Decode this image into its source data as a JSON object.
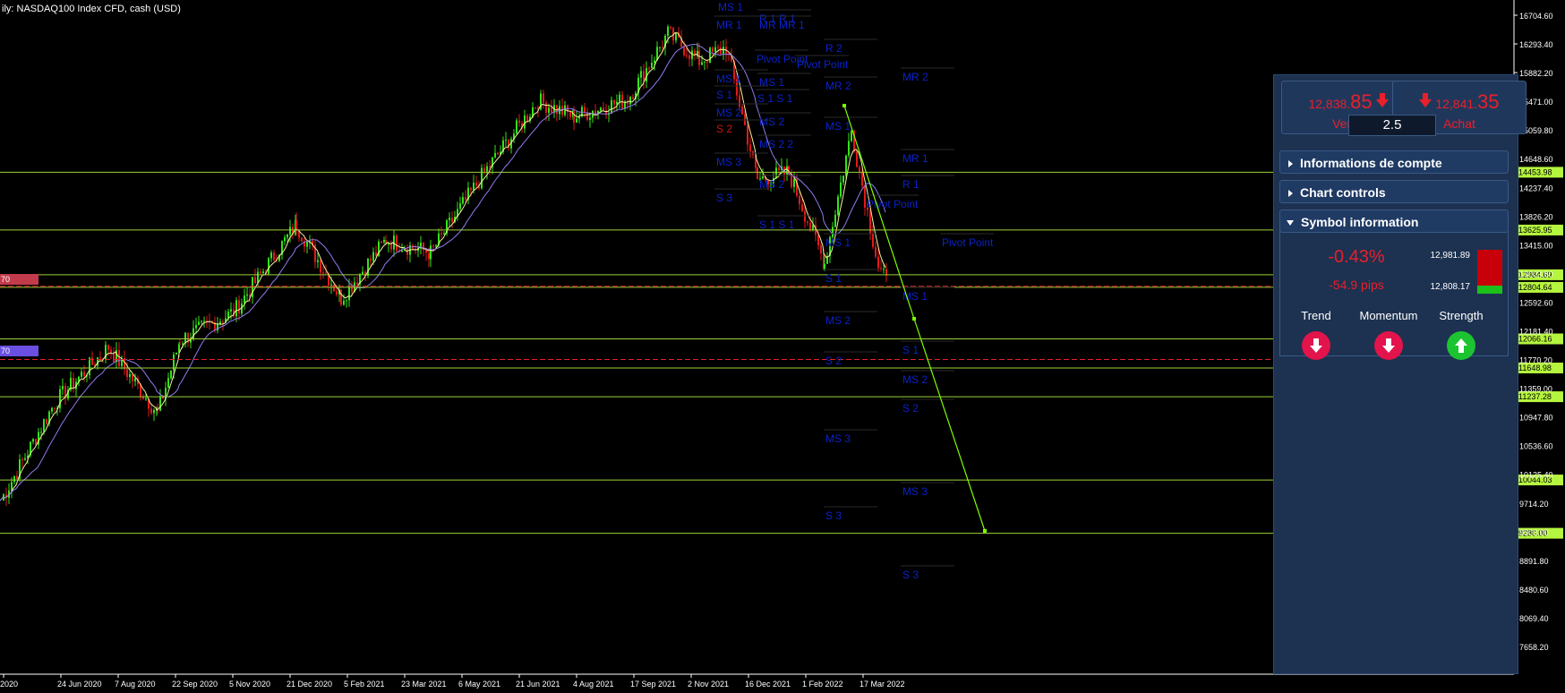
{
  "window": {
    "title": "ily:  NASDAQ100 Index CFD, cash (USD)"
  },
  "colors": {
    "accent_red": "#e8202b",
    "level_green": "#9cd23a",
    "pivot_blue": "#0a22c8",
    "panel_bg": "#1d3150",
    "trendline": "#7cff00"
  },
  "chart": {
    "price_ticks": [
      "16704.60",
      "16293.40",
      "15882.20",
      "15471.00",
      "15059.80",
      "14648.60",
      "14237.40",
      "13826.20",
      "13415.00",
      "13003.80",
      "12592.60",
      "12181.40",
      "11770.20",
      "11359.00",
      "10947.80",
      "10536.60",
      "10125.40",
      "9714.20",
      "9303.00",
      "8891.80",
      "8480.60",
      "8069.40",
      "7658.20"
    ],
    "date_ticks": [
      "2020",
      "24 Jun 2020",
      "7 Aug 2020",
      "22 Sep 2020",
      "5 Nov 2020",
      "21 Dec 2020",
      "5 Feb 2021",
      "23 Mar 2021",
      "6 May 2021",
      "21 Jun 2021",
      "4 Aug 2021",
      "17 Sep 2021",
      "2 Nov 2021",
      "16 Dec 2021",
      "1 Feb 2022",
      "17 Mar 2022"
    ],
    "level_tags": [
      "14453.98",
      "13625.95",
      "12984.69",
      "12804.64",
      "12066.16",
      "11648.98",
      "11237.28",
      "10044.03",
      "9280.00"
    ],
    "left_tags": [
      "70",
      "70"
    ],
    "pivot_labels": [
      "MS 1",
      "MR 1",
      "R 1 R 1",
      "MR MR 1",
      "Pivot Point",
      "Pivot Point",
      "R 2",
      "MR 2",
      "MS 1",
      "MS 1",
      "S 1 S 1",
      "S 1",
      "MS 2",
      "MS 2",
      "MR 2",
      "S 2",
      "MS 2 2",
      "MS 3",
      "S 3",
      "MS 2",
      "MS 1",
      "R 1",
      "Pivot Point",
      "MR 1",
      "S 1 S 1",
      "MS 1",
      "Pivot Point",
      "S 1",
      "MS 1",
      "MS 2",
      "S 2",
      "MS 3",
      "S 1",
      "MS 2",
      "S 2",
      "MS 3",
      "S 3",
      "S 3"
    ]
  },
  "panel": {
    "sell": {
      "price_small": "12,838.",
      "price_big": "85",
      "label": "Vente"
    },
    "buy": {
      "price_small": "12,841.",
      "price_big": "35",
      "label": "Achat"
    },
    "lot": "2.5",
    "sections": {
      "account": "Informations de compte",
      "controls": "Chart controls",
      "symbol": "Symbol information"
    },
    "symbol": {
      "change_pct": "-0.43%",
      "change_pips": "-54.9 pips",
      "high": "12,981.89",
      "low": "12,808.17"
    },
    "indicators": [
      {
        "label": "Trend",
        "direction": "down"
      },
      {
        "label": "Momentum",
        "direction": "down"
      },
      {
        "label": "Strength",
        "direction": "up"
      }
    ]
  }
}
